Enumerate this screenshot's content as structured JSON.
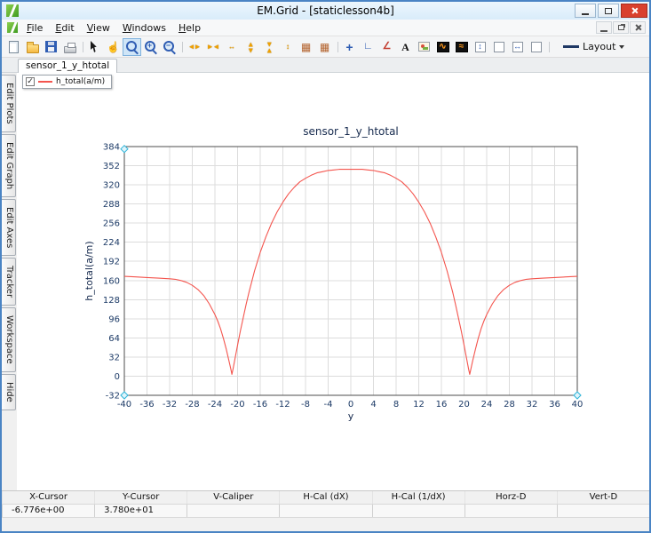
{
  "window": {
    "title": "EM.Grid - [staticlesson4b]"
  },
  "menu": {
    "items": [
      {
        "name": "menu-file",
        "label": "File"
      },
      {
        "name": "menu-edit",
        "label": "Edit"
      },
      {
        "name": "menu-view",
        "label": "View"
      },
      {
        "name": "menu-windows",
        "label": "Windows"
      },
      {
        "name": "menu-help",
        "label": "Help"
      }
    ]
  },
  "toolbar": {
    "layout_label": "Layout",
    "items": [
      {
        "name": "new-file-icon",
        "kind": "page",
        "glyph": ""
      },
      {
        "name": "open-file-icon",
        "kind": "folder",
        "glyph": ""
      },
      {
        "name": "save-icon",
        "kind": "floppy",
        "glyph": ""
      },
      {
        "name": "print-icon",
        "kind": "printer",
        "glyph": ""
      },
      {
        "name": "toolbar-separator",
        "kind": "sep",
        "glyph": ""
      },
      {
        "name": "select-cursor-icon",
        "kind": "cursor",
        "glyph": ""
      },
      {
        "name": "pan-hand-icon",
        "kind": "hand",
        "glyph": "☝"
      },
      {
        "name": "zoom-window-icon",
        "kind": "mag active",
        "glyph": ""
      },
      {
        "name": "zoom-in-icon",
        "kind": "mag",
        "glyph": "+"
      },
      {
        "name": "zoom-out-icon",
        "kind": "mag",
        "glyph": "−"
      },
      {
        "name": "toolbar-separator-2",
        "kind": "sep",
        "glyph": ""
      },
      {
        "name": "expand-x-axis-icon",
        "kind": "yarr",
        "glyph": "◄►"
      },
      {
        "name": "compress-x-axis-icon",
        "kind": "yarr",
        "glyph": "►◄"
      },
      {
        "name": "fit-x-axis-icon",
        "kind": "yarr",
        "glyph": "↔"
      },
      {
        "name": "expand-y-axis-icon",
        "kind": "yarr rot90",
        "glyph": "◄►"
      },
      {
        "name": "compress-y-axis-icon",
        "kind": "yarr rot90",
        "glyph": "►◄"
      },
      {
        "name": "fit-y-axis-icon",
        "kind": "yarr",
        "glyph": "↕"
      },
      {
        "name": "data-table-icon",
        "kind": "table",
        "glyph": "▦"
      },
      {
        "name": "data-table-2-icon",
        "kind": "table",
        "glyph": "▦"
      },
      {
        "name": "toolbar-separator-3",
        "kind": "sep",
        "glyph": ""
      },
      {
        "name": "crosshair-icon",
        "kind": "plus",
        "glyph": "+"
      },
      {
        "name": "axes-icon",
        "kind": "axes",
        "glyph": "∟"
      },
      {
        "name": "slope-icon",
        "kind": "slope",
        "glyph": "∠"
      },
      {
        "name": "text-label-icon",
        "kind": "texta",
        "glyph": "A"
      },
      {
        "name": "image-annotation-icon",
        "kind": "pic",
        "glyph": ""
      },
      {
        "name": "waveform-dark-icon",
        "kind": "wave",
        "glyph": "∿"
      },
      {
        "name": "waveform-gallery-icon",
        "kind": "wave",
        "glyph": "≈"
      },
      {
        "name": "vertical-caliper-icon",
        "kind": "boxg",
        "glyph": "↕"
      },
      {
        "name": "empty-box-icon",
        "kind": "boxg",
        "glyph": ""
      },
      {
        "name": "horizontal-caliper-icon",
        "kind": "boxg",
        "glyph": "↔"
      },
      {
        "name": "empty-box-2-icon",
        "kind": "boxg",
        "glyph": ""
      },
      {
        "name": "toolbar-separator-4",
        "kind": "sep",
        "glyph": ""
      }
    ]
  },
  "tabs": [
    {
      "name": "tab-sensor-1-y-htotal",
      "label": "sensor_1_y_htotal"
    }
  ],
  "sidebar": {
    "items": [
      {
        "name": "side-tab-edit-plots",
        "label": "Edit Plots"
      },
      {
        "name": "side-tab-edit-graph",
        "label": "Edit Graph"
      },
      {
        "name": "side-tab-edit-axes",
        "label": "Edit Axes"
      },
      {
        "name": "side-tab-tracker",
        "label": "Tracker"
      },
      {
        "name": "side-tab-workspace",
        "label": "Workspace"
      },
      {
        "name": "side-tab-hide",
        "label": "Hide"
      }
    ]
  },
  "legend": {
    "series_label": "h_total(a/m)",
    "checkbox_checked": true,
    "check_glyph": "✓"
  },
  "chart_data": {
    "type": "line",
    "title": "sensor_1_y_htotal",
    "xlabel": "y",
    "ylabel": "h_total(a/m)",
    "xlim": [
      -40,
      40
    ],
    "ylim": [
      -32,
      384
    ],
    "xticks": [
      -40,
      -36,
      -32,
      -28,
      -24,
      -20,
      -16,
      -12,
      -8,
      -4,
      0,
      4,
      8,
      12,
      16,
      20,
      24,
      28,
      32,
      36,
      40
    ],
    "yticks": [
      -32,
      0,
      32,
      64,
      96,
      128,
      160,
      192,
      224,
      256,
      288,
      320,
      352,
      384
    ],
    "grid": true,
    "legend_position": "top-left",
    "series": [
      {
        "name": "h_total(a/m)",
        "color": "#f4554e",
        "x": [
          -40,
          -38,
          -36,
          -34,
          -32,
          -31,
          -30,
          -29,
          -28,
          -27,
          -26,
          -25,
          -24,
          -23.5,
          -23,
          -22.5,
          -22,
          -21.5,
          -21.2,
          -21,
          -20.8,
          -20.5,
          -20,
          -19.5,
          -19,
          -18.5,
          -18,
          -17,
          -16,
          -15,
          -14,
          -13,
          -12,
          -11,
          -10,
          -9,
          -8,
          -7,
          -6,
          -5,
          -4,
          -3,
          -2,
          -1,
          0,
          1,
          2,
          3,
          4,
          5,
          6,
          7,
          8,
          9,
          10,
          11,
          12,
          13,
          14,
          15,
          16,
          17,
          18,
          18.5,
          19,
          19.5,
          20,
          20.5,
          20.8,
          21,
          21.2,
          21.5,
          22,
          22.5,
          23,
          23.5,
          24,
          25,
          26,
          27,
          28,
          29,
          30,
          31,
          32,
          34,
          36,
          38,
          40
        ],
        "y": [
          167,
          166,
          165,
          164,
          163,
          162,
          160,
          157,
          152,
          145,
          135,
          121,
          103,
          92,
          79,
          63,
          45,
          25,
          12,
          3,
          12,
          27,
          52,
          76,
          98,
          120,
          140,
          176,
          207,
          233,
          256,
          275,
          291,
          305,
          316,
          325,
          331,
          336,
          340,
          342,
          344,
          345,
          346,
          346,
          346,
          346,
          346,
          345,
          344,
          342,
          340,
          336,
          331,
          325,
          316,
          305,
          291,
          275,
          256,
          233,
          207,
          176,
          140,
          120,
          98,
          76,
          52,
          27,
          12,
          3,
          12,
          25,
          45,
          63,
          79,
          92,
          103,
          121,
          135,
          145,
          152,
          157,
          160,
          162,
          163,
          164,
          165,
          166,
          167
        ]
      }
    ],
    "markers": [
      {
        "x": -40,
        "y": 380
      },
      {
        "x": -40,
        "y": -32
      },
      {
        "x": 40,
        "y": -32
      }
    ]
  },
  "statusbar": {
    "columns": [
      {
        "name": "status-col-x-cursor",
        "label": "X-Cursor",
        "value": "-6.776e+00"
      },
      {
        "name": "status-col-y-cursor",
        "label": "Y-Cursor",
        "value": "3.780e+01"
      },
      {
        "name": "status-col-v-caliper",
        "label": "V-Caliper",
        "value": ""
      },
      {
        "name": "status-col-h-cal-dx",
        "label": "H-Cal (dX)",
        "value": ""
      },
      {
        "name": "status-col-h-cal-1dx",
        "label": "H-Cal (1/dX)",
        "value": ""
      },
      {
        "name": "status-col-horz-d",
        "label": "Horz-D",
        "value": ""
      },
      {
        "name": "status-col-vert-d",
        "label": "Vert-D",
        "value": ""
      }
    ]
  }
}
